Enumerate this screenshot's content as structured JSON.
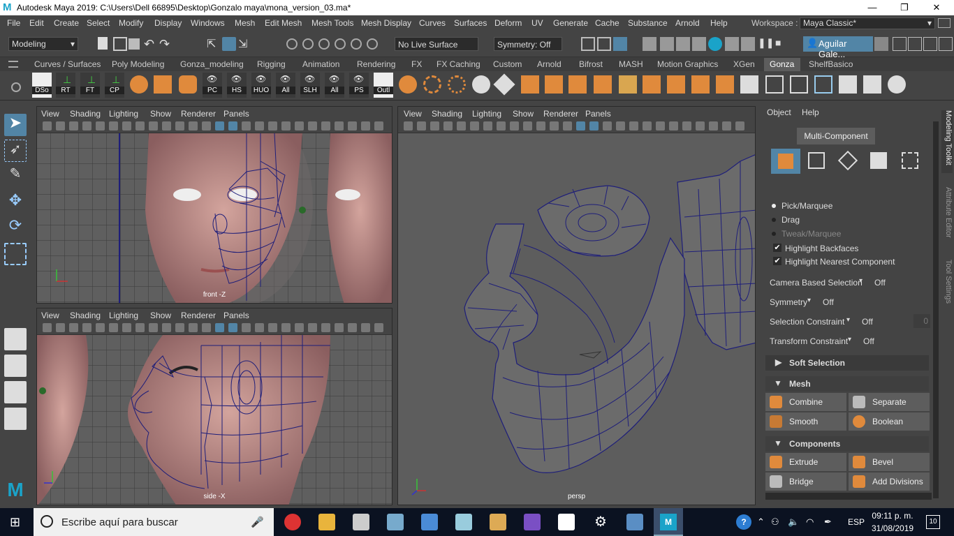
{
  "window": {
    "title": "Autodesk Maya 2019: C:\\Users\\Dell 66895\\Desktop\\Gonzalo maya\\mona_version_03.ma*",
    "minimize": "—",
    "restore": "❐",
    "close": "✕"
  },
  "menu": [
    "File",
    "Edit",
    "Create",
    "Select",
    "Modify",
    "Display",
    "Windows",
    "Mesh",
    "Edit Mesh",
    "Mesh Tools",
    "Mesh Display",
    "Curves",
    "Surfaces",
    "Deform",
    "UV",
    "Generate",
    "Cache",
    "Substance",
    "Arnold",
    "Help"
  ],
  "workspace": {
    "label": "Workspace :",
    "value": "Maya Classic*"
  },
  "status": {
    "mode": "Modeling",
    "live_surface": "No Live Surface",
    "symmetry": "Symmetry: Off",
    "user": "Aguilar Gale..."
  },
  "shelf_tabs": [
    "Curves / Surfaces",
    "Poly Modeling",
    "Gonza_modeling",
    "Rigging",
    "Animation",
    "Rendering",
    "FX",
    "FX Caching",
    "Custom",
    "Arnold",
    "Bifrost",
    "MASH",
    "Motion Graphics",
    "XGen",
    "Gonza",
    "ShelfBasico"
  ],
  "shelf_active": "Gonza",
  "shelf_labels": [
    "DSo",
    "RT",
    "FT",
    "CP",
    "PC",
    "HS",
    "HUO",
    "All",
    "SLH",
    "All",
    "PS",
    "Outl"
  ],
  "viewport_menu": [
    "View",
    "Shading",
    "Lighting",
    "Show",
    "Renderer",
    "Panels"
  ],
  "viewports": {
    "front": "front -Z",
    "side": "side -X",
    "persp": "persp"
  },
  "modeling_toolkit": {
    "menu": [
      "Object",
      "Help"
    ],
    "mode_button": "Multi-Component",
    "pick_marquee": "Pick/Marquee",
    "drag": "Drag",
    "tweak_marquee": "Tweak/Marquee",
    "highlight_backfaces": "Highlight Backfaces",
    "highlight_nearest": "Highlight Nearest Component",
    "camera_based_selection": "Camera Based Selection",
    "camera_based_value": "Off",
    "symmetry": "Symmetry",
    "symmetry_value": "Off",
    "selection_constraint": "Selection Constraint",
    "selection_constraint_value": "Off",
    "selection_constraint_num": "0",
    "transform_constraint": "Transform Constraint",
    "transform_constraint_value": "Off",
    "soft_selection": "Soft Selection",
    "mesh_section": "Mesh",
    "combine": "Combine",
    "separate": "Separate",
    "smooth": "Smooth",
    "boolean": "Boolean",
    "components_section": "Components",
    "extrude": "Extrude",
    "bevel": "Bevel",
    "bridge": "Bridge",
    "add_divisions": "Add Divisions"
  },
  "side_tabs": [
    "Modeling Toolkit",
    "Attribute Editor",
    "Tool Settings"
  ],
  "taskbar": {
    "search_placeholder": "Escribe aquí para buscar",
    "lang": "ESP",
    "time": "09:11 p. m.",
    "date": "31/08/2019",
    "notif": "10"
  },
  "colors": {
    "maya_ui": "#444444",
    "accent": "#5285a6",
    "wire": "#1e1e7a",
    "taskbar": "#0b1221"
  }
}
